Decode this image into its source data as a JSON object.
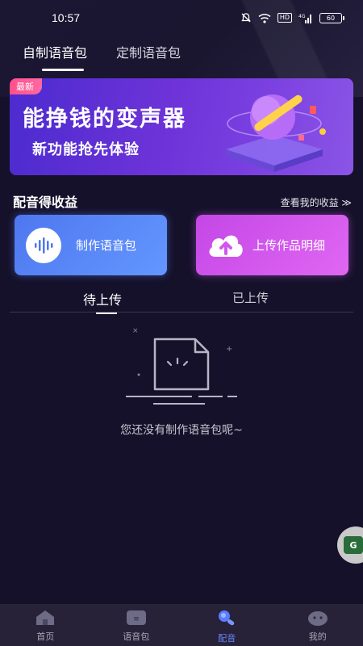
{
  "status_bar": {
    "time": "10:57",
    "hd": "HD",
    "signal": "4G",
    "battery": "60"
  },
  "top_tabs": [
    {
      "label": "自制语音包",
      "active": true
    },
    {
      "label": "定制语音包",
      "active": false
    }
  ],
  "banner": {
    "tag": "最新",
    "title": "能挣钱的变声器",
    "subtitle": "新功能抢先体验"
  },
  "earnings": {
    "title": "配音得收益",
    "link": "查看我的收益 ≫"
  },
  "cards": {
    "make": {
      "label": "制作语音包"
    },
    "upload": {
      "label": "上传作品明细"
    }
  },
  "sub_tabs": {
    "pending": "待上传",
    "uploaded": "已上传"
  },
  "empty_state": {
    "text": "您还没有制作语音包呢~"
  },
  "bottom_nav": [
    {
      "label": "首页",
      "icon": "home-icon"
    },
    {
      "label": "语音包",
      "icon": "voice-pack-icon"
    },
    {
      "label": "配音",
      "icon": "dubbing-icon",
      "active": true
    },
    {
      "label": "我的",
      "icon": "profile-icon"
    }
  ],
  "colors": {
    "background": "#15112a",
    "accent": "#6a86ff",
    "card_make": "#5b88fa",
    "card_upload": "#d35bee",
    "banner": "#6d33d8"
  }
}
